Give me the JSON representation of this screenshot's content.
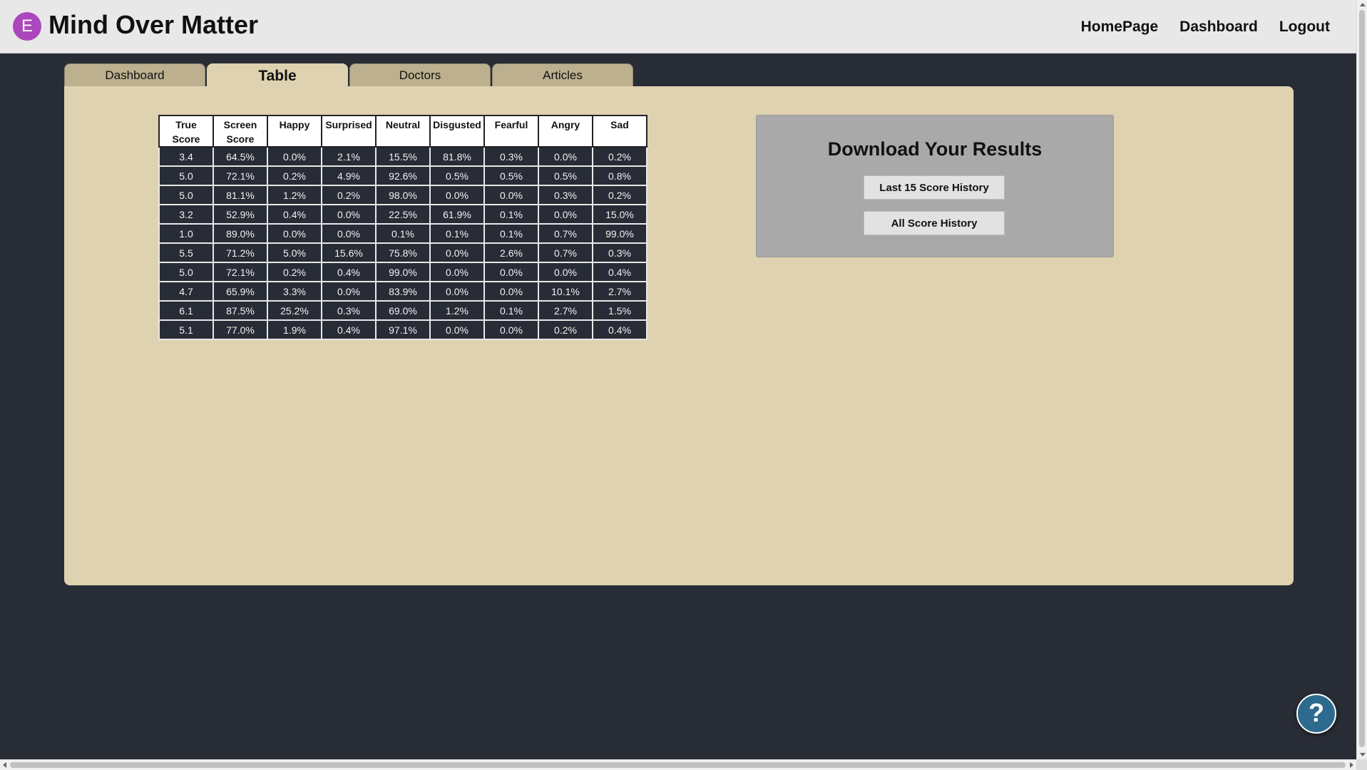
{
  "header": {
    "avatar_letter": "E",
    "title": "Mind Over Matter",
    "nav": [
      "HomePage",
      "Dashboard",
      "Logout"
    ]
  },
  "tabs": [
    {
      "label": "Dashboard",
      "active": false
    },
    {
      "label": "Table",
      "active": true
    },
    {
      "label": "Doctors",
      "active": false
    },
    {
      "label": "Articles",
      "active": false
    }
  ],
  "table": {
    "headers": [
      "True Score",
      "Screen Score",
      "Happy",
      "Surprised",
      "Neutral",
      "Disgusted",
      "Fearful",
      "Angry",
      "Sad"
    ],
    "rows": [
      [
        "3.4",
        "64.5%",
        "0.0%",
        "2.1%",
        "15.5%",
        "81.8%",
        "0.3%",
        "0.0%",
        "0.2%"
      ],
      [
        "5.0",
        "72.1%",
        "0.2%",
        "4.9%",
        "92.6%",
        "0.5%",
        "0.5%",
        "0.5%",
        "0.8%"
      ],
      [
        "5.0",
        "81.1%",
        "1.2%",
        "0.2%",
        "98.0%",
        "0.0%",
        "0.0%",
        "0.3%",
        "0.2%"
      ],
      [
        "3.2",
        "52.9%",
        "0.4%",
        "0.0%",
        "22.5%",
        "61.9%",
        "0.1%",
        "0.0%",
        "15.0%"
      ],
      [
        "1.0",
        "89.0%",
        "0.0%",
        "0.0%",
        "0.1%",
        "0.1%",
        "0.1%",
        "0.7%",
        "99.0%"
      ],
      [
        "5.5",
        "71.2%",
        "5.0%",
        "15.6%",
        "75.8%",
        "0.0%",
        "2.6%",
        "0.7%",
        "0.3%"
      ],
      [
        "5.0",
        "72.1%",
        "0.2%",
        "0.4%",
        "99.0%",
        "0.0%",
        "0.0%",
        "0.0%",
        "0.4%"
      ],
      [
        "4.7",
        "65.9%",
        "3.3%",
        "0.0%",
        "83.9%",
        "0.0%",
        "0.0%",
        "10.1%",
        "2.7%"
      ],
      [
        "6.1",
        "87.5%",
        "25.2%",
        "0.3%",
        "69.0%",
        "1.2%",
        "0.1%",
        "2.7%",
        "1.5%"
      ],
      [
        "5.1",
        "77.0%",
        "1.9%",
        "0.4%",
        "97.1%",
        "0.0%",
        "0.0%",
        "0.2%",
        "0.4%"
      ]
    ]
  },
  "download": {
    "title": "Download Your Results",
    "buttons": [
      "Last 15 Score History",
      "All Score History"
    ]
  },
  "help": {
    "icon": "question-icon",
    "glyph": "?"
  },
  "colors": {
    "background": "#282c35",
    "topbar": "#e8e8e8",
    "panel": "#ded2b0",
    "tab_inactive": "#bdb08f",
    "avatar": "#ab47bc",
    "download_box": "#a9a9a9",
    "table_cell": "#272c36",
    "help_button": "#2d6b8e"
  }
}
